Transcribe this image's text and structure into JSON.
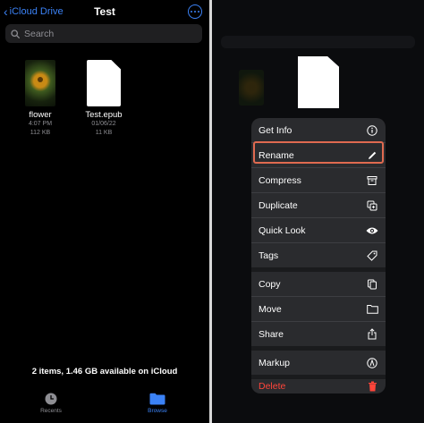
{
  "left": {
    "nav": {
      "back_label": "iCloud Drive",
      "title": "Test"
    },
    "search": {
      "placeholder": "Search"
    },
    "files": [
      {
        "name": "flower",
        "time": "4:07 PM",
        "size": "112 KB"
      },
      {
        "name": "Test.epub",
        "date": "01/06/22",
        "size": "11 KB"
      }
    ],
    "storage_text": "2 items, 1.46 GB available on iCloud",
    "tabs": [
      {
        "label": "Recents",
        "icon": "clock-icon",
        "active": false
      },
      {
        "label": "Browse",
        "icon": "folder-icon",
        "active": true
      }
    ]
  },
  "context_menu": {
    "items": [
      {
        "label": "Get Info",
        "icon": "info-icon"
      },
      {
        "label": "Rename",
        "icon": "pencil-icon",
        "highlighted": true
      },
      {
        "label": "Compress",
        "icon": "archive-box-icon"
      },
      {
        "label": "Duplicate",
        "icon": "duplicate-icon"
      },
      {
        "label": "Quick Look",
        "icon": "eye-icon"
      },
      {
        "label": "Tags",
        "icon": "tag-icon"
      },
      {
        "label": "Copy",
        "icon": "copy-icon"
      },
      {
        "label": "Move",
        "icon": "folder-icon"
      },
      {
        "label": "Share",
        "icon": "share-icon"
      },
      {
        "label": "Markup",
        "icon": "markup-icon"
      },
      {
        "label": "Delete",
        "icon": "trash-icon",
        "destructive": true
      }
    ]
  },
  "colors": {
    "accent": "#3b82f6",
    "destructive": "#ff453a",
    "highlight_border": "#e06a50",
    "menu_bg": "#2a2b2e"
  }
}
